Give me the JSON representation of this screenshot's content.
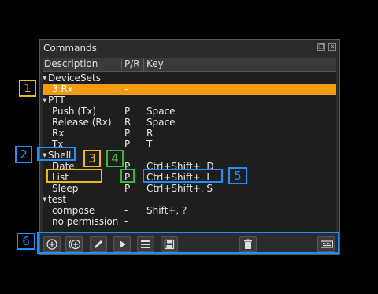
{
  "window": {
    "title": "Commands"
  },
  "columns": {
    "description": "Description",
    "pr": "P/R",
    "key": "Key"
  },
  "groups": [
    {
      "label": "DeviceSets",
      "commands": [
        {
          "desc": "3 Rx",
          "pr": "-",
          "key": ""
        }
      ]
    },
    {
      "label": "PTT",
      "commands": [
        {
          "desc": "Push (Tx)",
          "pr": "P",
          "key": "Space"
        },
        {
          "desc": "Release (Rx)",
          "pr": "R",
          "key": "Space"
        },
        {
          "desc": "Rx",
          "pr": "P",
          "key": "R"
        },
        {
          "desc": "Tx",
          "pr": "P",
          "key": "T"
        }
      ]
    },
    {
      "label": "Shell",
      "commands": [
        {
          "desc": "Date",
          "pr": "P",
          "key": "Ctrl+Shift+, D"
        },
        {
          "desc": "List",
          "pr": "P",
          "key": "Ctrl+Shift+, L"
        },
        {
          "desc": "Sleep",
          "pr": "P",
          "key": "Ctrl+Shift+, S"
        }
      ]
    },
    {
      "label": "test",
      "commands": [
        {
          "desc": "compose",
          "pr": "-",
          "key": "Shift+, ?"
        },
        {
          "desc": "no permission",
          "pr": "-",
          "key": ""
        }
      ]
    }
  ],
  "selected_row": "3 Rx",
  "toolbar_icons": [
    "add-icon",
    "add-from-device-icon",
    "edit-icon",
    "run-icon",
    "list-icon",
    "save-icon",
    "delete-icon",
    "keyboard-icon"
  ],
  "callouts": [
    "1",
    "2",
    "3",
    "4",
    "5",
    "6"
  ],
  "colors": {
    "selection": "#f29a11",
    "callout_blue": "#1e90ff",
    "callout_yellow": "#f0b818",
    "callout_green": "#3cb43c"
  }
}
